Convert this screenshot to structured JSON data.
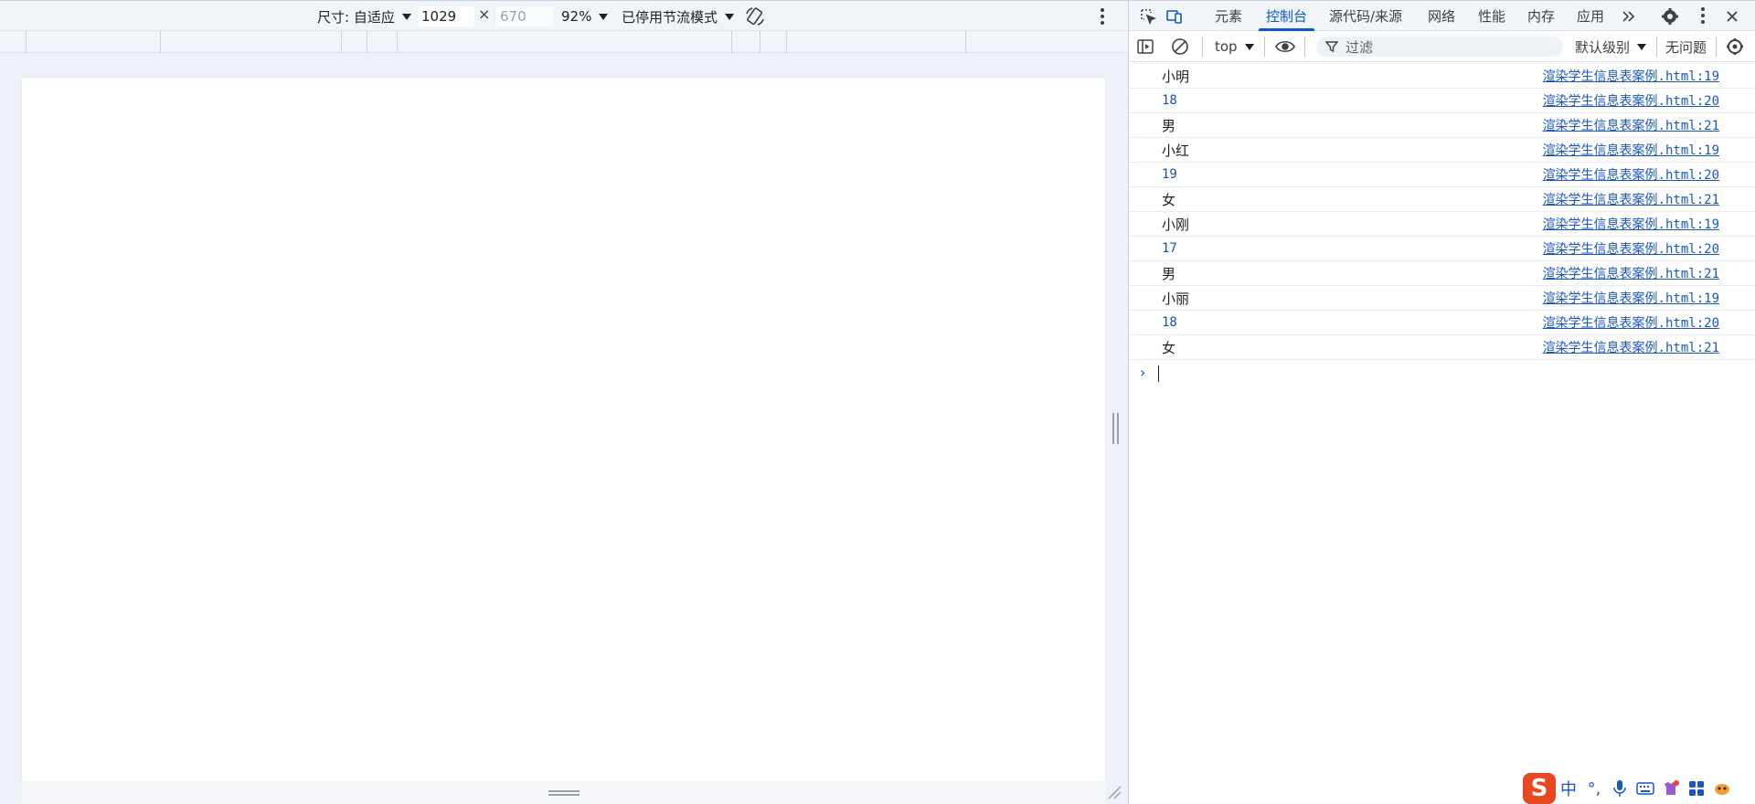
{
  "device_toolbar": {
    "size_label": "尺寸: 自适应",
    "width": "1029",
    "height": "670",
    "times": "×",
    "zoom": "92%",
    "throttle": "已停用节流模式"
  },
  "devtools": {
    "tabs": [
      "元素",
      "控制台",
      "源代码/来源",
      "网络",
      "性能",
      "内存",
      "应用"
    ],
    "active_tab": "控制台",
    "console_toolbar": {
      "context": "top",
      "filter_placeholder": "过滤",
      "levels": "默认级别",
      "issues": "无问题"
    },
    "console_messages": [
      {
        "text": "小明",
        "type": "string",
        "source": "渲染学生信息表案例.html:19"
      },
      {
        "text": "18",
        "type": "number",
        "source": "渲染学生信息表案例.html:20"
      },
      {
        "text": "男",
        "type": "string",
        "source": "渲染学生信息表案例.html:21"
      },
      {
        "text": "小红",
        "type": "string",
        "source": "渲染学生信息表案例.html:19"
      },
      {
        "text": "19",
        "type": "number",
        "source": "渲染学生信息表案例.html:20"
      },
      {
        "text": "女",
        "type": "string",
        "source": "渲染学生信息表案例.html:21"
      },
      {
        "text": "小刚",
        "type": "string",
        "source": "渲染学生信息表案例.html:19"
      },
      {
        "text": "17",
        "type": "number",
        "source": "渲染学生信息表案例.html:20"
      },
      {
        "text": "男",
        "type": "string",
        "source": "渲染学生信息表案例.html:21"
      },
      {
        "text": "小丽",
        "type": "string",
        "source": "渲染学生信息表案例.html:19"
      },
      {
        "text": "18",
        "type": "number",
        "source": "渲染学生信息表案例.html:20"
      },
      {
        "text": "女",
        "type": "string",
        "source": "渲染学生信息表案例.html:21"
      }
    ],
    "prompt": "›"
  },
  "ime": {
    "logo": "S",
    "mode": "中",
    "punct": "°,"
  },
  "colors": {
    "accent": "#0b57d0",
    "link": "#1a56c4",
    "toolbar_bg": "#f1f4f9",
    "ime_brand": "#e8481f"
  }
}
